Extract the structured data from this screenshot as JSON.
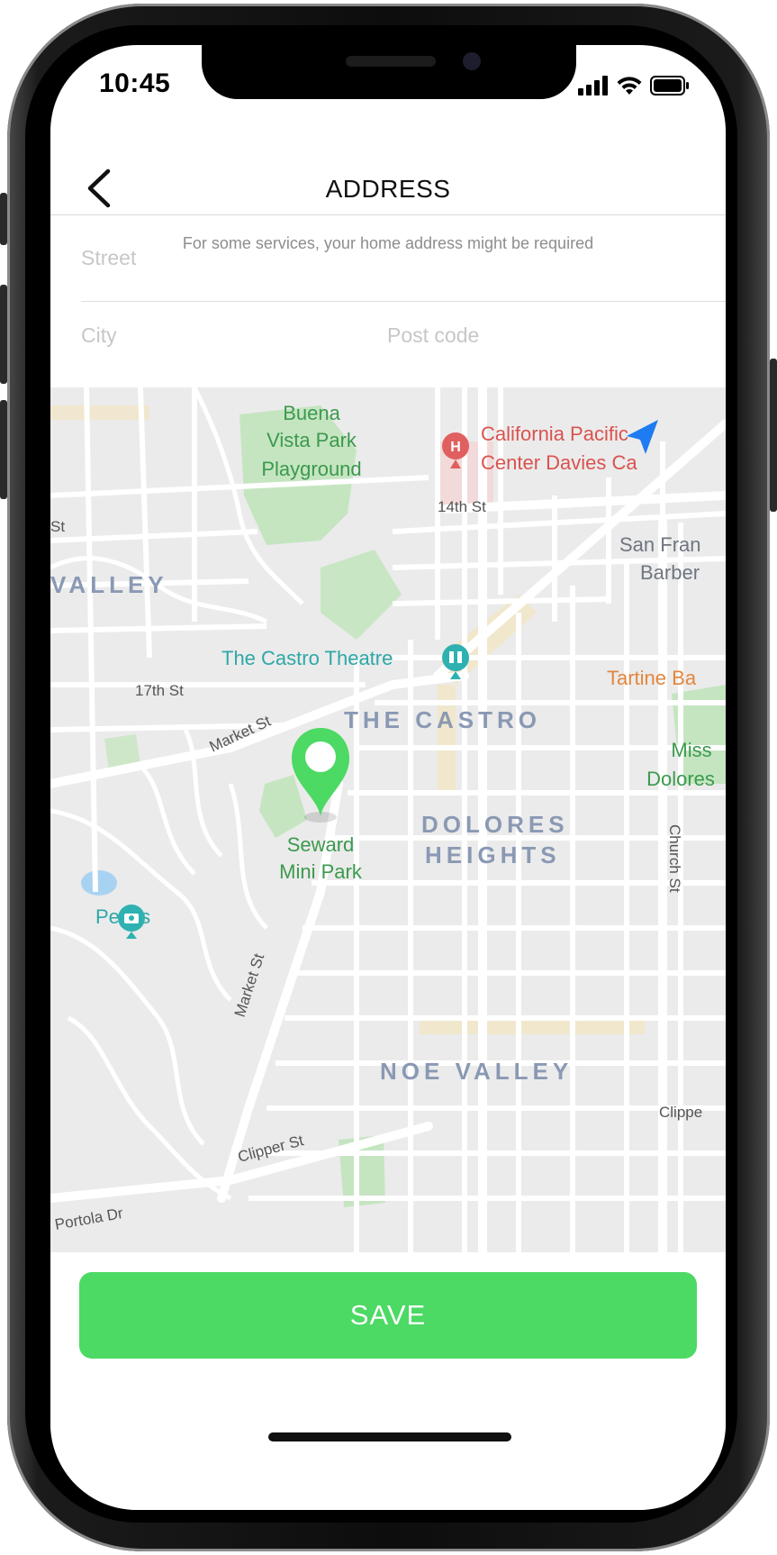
{
  "status_bar": {
    "time": "10:45",
    "icons": [
      "signal-icon",
      "wifi-icon",
      "battery-icon"
    ]
  },
  "header": {
    "back_icon": "chevron-left-icon",
    "title": "ADDRESS",
    "subtitle": "For some services, your home address might be required"
  },
  "form": {
    "street": {
      "value": "",
      "placeholder": "Street"
    },
    "city": {
      "value": "",
      "placeholder": "City"
    },
    "post_code": {
      "value": "",
      "placeholder": "Post code"
    }
  },
  "map": {
    "pin_icon": "map-pin-icon",
    "location_arrow_icon": "location-arrow-icon",
    "labels": {
      "buena_1": "Buena",
      "buena_2": "Vista Park",
      "buena_3": "Playground",
      "cpmc_1": "California Pacific",
      "cpmc_2": "Center Davies Ca",
      "st14": "14th St",
      "sf_1": "San Fran",
      "sf_2": "Barber",
      "valley": "VALLEY",
      "st_left": "St",
      "castro_theatre": "The Castro Theatre",
      "tartine": "Tartine Ba",
      "st17": "17th St",
      "market_1": "Market St",
      "castro": "THE CASTRO",
      "miss_1": "Miss",
      "miss_2": "Dolores",
      "seward_1": "Seward",
      "seward_2": "Mini Park",
      "dolores_1": "DOLORES",
      "dolores_2": "HEIGHTS",
      "church": "Church St",
      "peaks": "Peaks",
      "market_2": "Market St",
      "noe": "NOE VALLEY",
      "clipper_1": "Clipper St",
      "clipper_2": "Clippe",
      "portola": "Portola Dr"
    }
  },
  "save_button": {
    "label": "SAVE"
  },
  "colors": {
    "accent": "#4cd964",
    "map_bg": "#ececec",
    "park": "#c5e5c1",
    "label_blue": "#8a99b3",
    "label_teal": "#2fa7a7",
    "label_green": "#3b9a4d",
    "label_red": "#d9534f",
    "label_orange": "#e2863e"
  }
}
